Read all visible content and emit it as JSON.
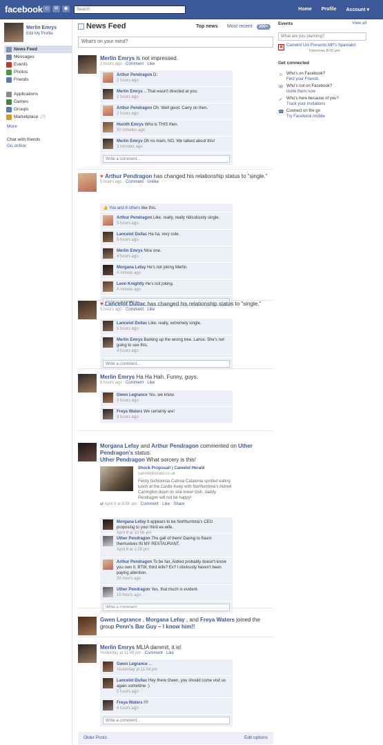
{
  "header": {
    "logo": "facebook",
    "search_placeholder": "Search",
    "links": [
      "Home",
      "Profile",
      "Account ▾"
    ]
  },
  "left": {
    "user_name": "Merlin Emrys",
    "edit_profile": "Edit My Profile",
    "nav_primary": [
      {
        "label": "News Feed",
        "icon": "news-feed-icon",
        "color": "#7f93bc"
      },
      {
        "label": "Messages",
        "icon": "messages-icon",
        "color": "#6d84b4"
      },
      {
        "label": "Events",
        "icon": "events-icon",
        "color": "#c0392b"
      },
      {
        "label": "Photos",
        "icon": "photos-icon",
        "color": "#4a9a3c"
      },
      {
        "label": "Friends",
        "icon": "friends-icon",
        "color": "#5b7bb4"
      }
    ],
    "nav_secondary": [
      {
        "label": "Applications",
        "icon": "applications-icon",
        "color": "#8a8a8a"
      },
      {
        "label": "Games",
        "icon": "games-icon",
        "color": "#3c8a3c"
      },
      {
        "label": "Groups",
        "icon": "groups-icon",
        "color": "#5b7bb4"
      },
      {
        "label": "Marketplace",
        "count": "(7)",
        "icon": "marketplace-icon",
        "color": "#d99a1e"
      }
    ],
    "more": "More",
    "chat_with_friends": "Chat with friends",
    "go_online": "Go online"
  },
  "feed": {
    "title": "News Feed",
    "top_news": "Top news",
    "separator": "·",
    "most_recent": "Most recent",
    "count": "300+",
    "composer_placeholder": "What's on your mind?",
    "write_comment": "Write a comment...",
    "older_posts": "Older Posts",
    "edit_options": "Edit options",
    "stories": [
      {
        "actor": "Merlin Emrys",
        "text": "is not impressed.",
        "time": "2 hours ago",
        "actions": [
          "Comment",
          "Like"
        ],
        "comments": [
          {
            "name": "Arthur Pendragon",
            "text": "D:",
            "time": "2 hours ago"
          },
          {
            "name": "Merlin Emrys",
            "text": "...That wasn't directed at you.",
            "time": "2 hours ago"
          },
          {
            "name": "Arthur Pendragon",
            "text": "Oh. Well good. Carry on then.",
            "time": "2 hours ago"
          },
          {
            "name": "Hunith Emrys",
            "text": "Who is THIS then.",
            "time": "30 minutes ago"
          },
          {
            "name": "Merlin Emrys",
            "text": "Oh no mam, NO. We talked about this!",
            "time": "3 minutes ago"
          }
        ]
      },
      {
        "actor": "Arthur Pendragon",
        "text": "has changed his relationship status to \"single.\"",
        "time": "5 hours ago",
        "actions": [
          "Comment",
          "Unlike"
        ],
        "likes": {
          "you": "You and",
          "others": "8 others",
          "tail": "like this."
        },
        "comments": [
          {
            "name": "Arthur Pendragon",
            "text": "Like, really, really ridiculously single.",
            "time": "5 hours ago"
          },
          {
            "name": "Lancelot Dullac",
            "text": "Ha ha, very cute.",
            "time": "5 hours ago"
          },
          {
            "name": "Merlin Emrys",
            "text": "Nice one.",
            "time": "4 hours ago"
          },
          {
            "name": "Morgana Lefay",
            "text": "He's not joking Merlin.",
            "time": "A minute ago"
          },
          {
            "name": "Leon Knightly",
            "text": "He's not joking.",
            "time": "A minute ago"
          }
        ]
      },
      {
        "actor": "Lancelot Dullac",
        "text": "has changed his relationship status to \"single.\"",
        "time": "5 hours ago",
        "actions": [
          "Comment",
          "Like"
        ],
        "comments": [
          {
            "name": "Lancelot Dullac",
            "text": "Like, really, extremely single.",
            "time": "5 hours ago"
          },
          {
            "name": "Merlin Emrys",
            "text": "Barking up the wrong tree, Lance. She's not going to see this.",
            "time": "4 hours ago"
          }
        ]
      },
      {
        "actor": "Merlin Emrys",
        "text": "Ha Ha Hah. Funny, guys.",
        "time": "8 hours ago",
        "actions": [
          "Comment",
          "Like"
        ],
        "comments": [
          {
            "name": "Gwen Legrance",
            "text": "Yes, we know.",
            "time": "8 hours ago"
          },
          {
            "name": "Freya Waters",
            "text": "We certainly are!",
            "time": "8 hours ago"
          }
        ]
      },
      {
        "actors": [
          "Morgana Lefay",
          "Arthur Pendragon",
          "Uther Pendragon's"
        ],
        "joiners": [
          "and",
          "commented on",
          "status:"
        ],
        "status_author": "Uther Pendragon",
        "status_text": "What sorcery is this!",
        "link": {
          "title": "Shock Proposal! | Camelot Herald",
          "host": "camelotherald.co.uk",
          "desc": "Feisty fashionista Catrina Catalonia spotted eating lunch at the Castle Keep with Northumbria's Aldred Carrington down on one knee! Ooh, daddy Pendragon will not be happy!"
        },
        "time": "April 8 at 8:56 am",
        "actions": [
          "Comment",
          "Like",
          "Share"
        ],
        "comments": [
          {
            "name": "Morgana Lefay",
            "text": "It appears to be Northumbria's CEO proposing to your third ex-wife.",
            "time": "April 8 at 10:06 am"
          },
          {
            "name": "Uther Pendragon",
            "text": "The gall of them! Daring to flaunt themselves IN MY RESTAURANT.",
            "time": "April 8 at 1:15 pm"
          },
          {
            "name": "Arthur Pendragon",
            "text": "To be fair, Aldred probably doesn't know you own it. BTW, third wife? Ex? I obviously haven't been paying attention.",
            "time": "20 hours ago"
          },
          {
            "name": "Uther Pendragon",
            "text": "Yes, that much is evident.",
            "time": "15 hours ago"
          }
        ]
      },
      {
        "actors": [
          "Gwen Legrance",
          "Morgana Lefay",
          "Freya Waters"
        ],
        "joiners": [
          ",",
          ", and",
          "joined the group"
        ],
        "group": "Penn's Bar Guy – I know him!!"
      },
      {
        "actor": "Merlin Emrys",
        "text": "MLIA dammit, it is!",
        "time": "Yesterday at 11:49 pm",
        "actions": [
          "Comment",
          "Like"
        ],
        "comments": [
          {
            "name": "Gwen Legrance",
            "text": "...",
            "time": "Yesterday at 11:54 pm"
          },
          {
            "name": "Lancelot Dullac",
            "text": "Hey there Gwen, you should come visit us again sometime :)",
            "time": "5 hours ago"
          },
          {
            "name": "Freya Waters",
            "text": "!!!!",
            "time": "4 hours ago"
          }
        ]
      }
    ]
  },
  "right": {
    "events_title": "Events",
    "view_all": "View all",
    "planning_placeholder": "What are you planning?",
    "event_name": "Camelot Uni Presents MP's Spamalot",
    "event_time": "Tomorrow 8:00 pm",
    "get_connected": "Get connected",
    "connect": [
      {
        "line1": "Who's on Facebook?",
        "line2": "Find your Friends",
        "icon": "people-icon"
      },
      {
        "line1": "Who's not on Facebook?",
        "line2": "Invite them now",
        "icon": "invite-icon"
      },
      {
        "line1": "Who's here because of you?",
        "line2": "Track your invitations",
        "icon": "track-icon"
      },
      {
        "line1": "Connect on the go",
        "line2": "Try Facebook mobile",
        "icon": "mobile-icon"
      }
    ]
  }
}
